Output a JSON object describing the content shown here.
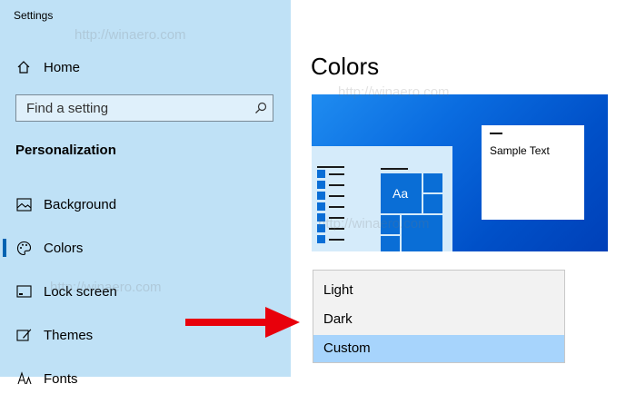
{
  "window": {
    "title": "Settings"
  },
  "sidebar": {
    "home_label": "Home",
    "search_placeholder": "Find a setting",
    "section_title": "Personalization",
    "items": [
      {
        "label": "Background",
        "icon": "picture-icon"
      },
      {
        "label": "Colors",
        "icon": "palette-icon",
        "active": true
      },
      {
        "label": "Lock screen",
        "icon": "lock-screen-icon"
      },
      {
        "label": "Themes",
        "icon": "themes-icon"
      },
      {
        "label": "Fonts",
        "icon": "fonts-icon"
      }
    ]
  },
  "main": {
    "title": "Colors",
    "preview": {
      "sample_text": "Sample Text",
      "tile_label": "Aa"
    },
    "mode_dropdown": {
      "options": [
        "Light",
        "Dark",
        "Custom"
      ],
      "selected": "Custom"
    }
  },
  "watermark": "http://winaero.com",
  "colors": {
    "sidebar_bg": "#bfe1f6",
    "accent": "#0063b1",
    "selected_option": "#a7d4fc",
    "arrow": "#e8000b"
  }
}
